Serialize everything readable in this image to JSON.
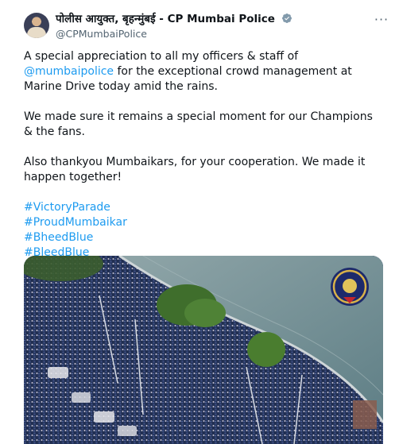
{
  "author": {
    "display_name": "पोलीस आयुक्त, बृहन्मुंबई - CP Mumbai Police",
    "handle": "@CPMumbaiPolice",
    "verified": true,
    "verified_color": "#829aab"
  },
  "more_label": "···",
  "tweet": {
    "p1_prefix": "A special appreciation to all my officers & staff of ",
    "p1_mention": "@mumbaipolice",
    "p1_suffix": " for the exceptional crowd management at Marine Drive today amid the rains.",
    "p2": "We made sure it remains a special moment for our Champions & the fans.",
    "p3": "Also thankyou Mumbaikars, for your cooperation. We made it happen together!",
    "hashtags": [
      "#VictoryParade",
      "#ProudMumbaikar",
      "#BheedBlue",
      "#BleedBlue"
    ]
  },
  "colors": {
    "link": "#1d9bf0",
    "secondary_text": "#536471"
  },
  "media": {
    "alt": "Aerial photo of a massive crowd at Marine Drive beside the sea, with Mumbai Police emblem"
  }
}
